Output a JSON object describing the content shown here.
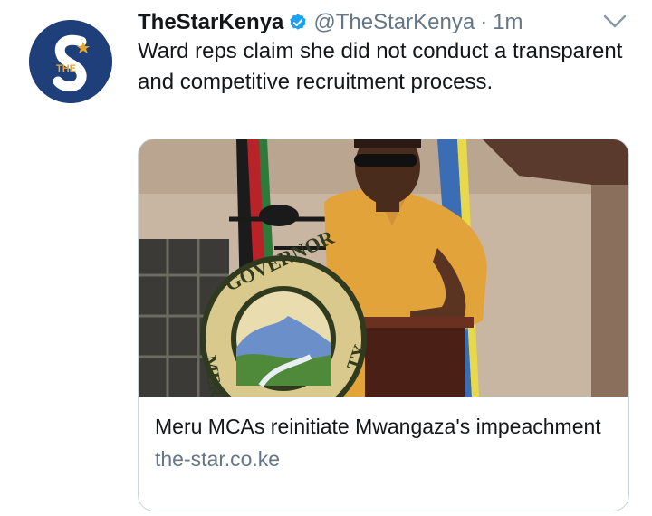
{
  "tweet": {
    "display_name": "TheStarKenya",
    "handle": "@TheStarKenya",
    "separator": "·",
    "time": "1m",
    "text": "Ward reps claim she did not conduct a transparent and competitive recruitment process.",
    "verified_icon": "verified-badge-icon",
    "menu_icon": "chevron-down-icon"
  },
  "avatar": {
    "letter": "S",
    "word": "THE",
    "bg_color": "#1f3f7a"
  },
  "card": {
    "title": "Meru MCAs reinitiate Mwangaza's impeachment",
    "domain": "the-star.co.ke",
    "image_seal_text": "GOVERNOR",
    "image_seal_text_left": "MER",
    "image_seal_text_right": "TY"
  },
  "colors": {
    "verified": "#1da1f2",
    "secondary_text": "#657786",
    "border": "#ccd6dd"
  }
}
